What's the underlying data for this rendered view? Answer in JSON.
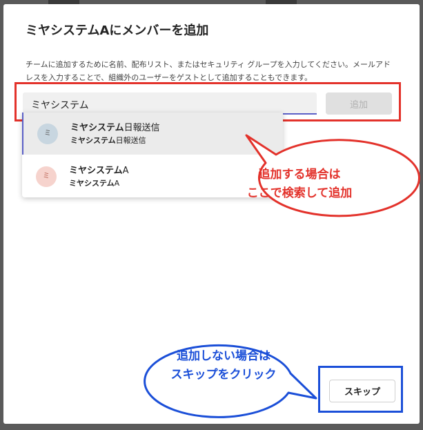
{
  "dialog": {
    "title": "ミヤシステムAにメンバーを追加",
    "description": "チームに追加するために名前、配布リスト、またはセキュリティ グループを入力してください。メールアドレスを入力することで、組織外のユーザーをゲストとして追加することもできます。"
  },
  "search": {
    "value": "ミヤシステム",
    "add_label": "追加"
  },
  "suggestions": [
    {
      "avatar": "ミ",
      "name_match": "ミヤシステム",
      "name_rest": "日報送信",
      "sub_match": "ミヤシステム",
      "sub_rest": "日報送信"
    },
    {
      "avatar": "ミ",
      "name_match": "ミヤシステム",
      "name_rest": "A",
      "sub_match": "ミヤシステム",
      "sub_rest": "A"
    }
  ],
  "annotations": {
    "add_line1": "追加する場合は",
    "add_line2": "ここで検索して追加",
    "skip_line1": "追加しない場合は",
    "skip_line2": "スキップをクリック"
  },
  "footer": {
    "skip_label": "スキップ"
  },
  "colors": {
    "accent": "#5b5fc7",
    "annotation_red": "#e3322b",
    "annotation_blue": "#1b4fd8"
  }
}
